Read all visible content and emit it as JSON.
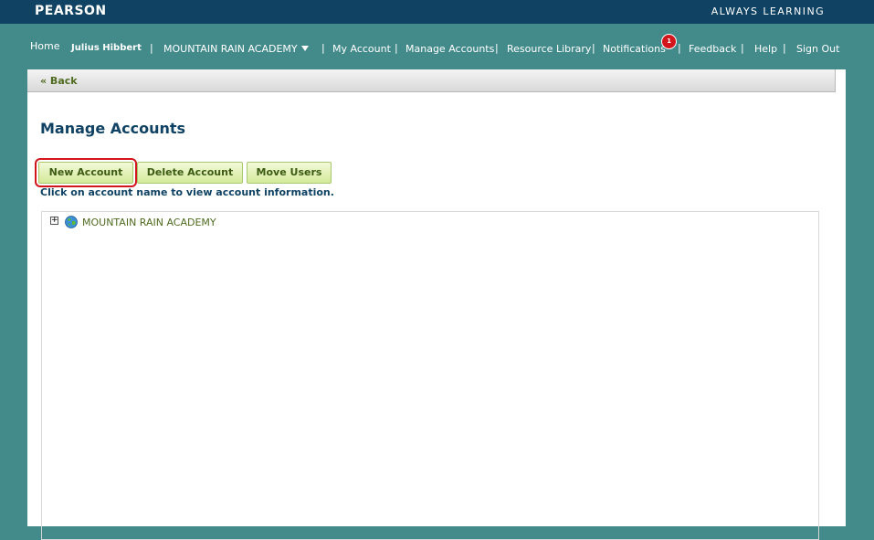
{
  "header": {
    "brand": "PEARSON",
    "tagline": "ALWAYS LEARNING"
  },
  "nav": {
    "home": "Home",
    "user": "Julius Hibbert",
    "org": "MOUNTAIN RAIN ACADEMY",
    "my_account": "My Account",
    "manage_accounts": "Manage Accounts",
    "resource_library": "Resource Library",
    "notifications": "Notifications",
    "notification_count": "1",
    "feedback": "Feedback",
    "help": "Help",
    "sign_out": "Sign Out",
    "separator": "|"
  },
  "backbar": {
    "back_label": "« Back"
  },
  "page": {
    "title": "Manage Accounts",
    "hint": "Click on account name to view account information."
  },
  "toolbar": {
    "new_account": "New Account",
    "delete_account": "Delete Account",
    "move_users": "Move Users"
  },
  "tree": {
    "items": [
      {
        "label": "MOUNTAIN RAIN ACADEMY",
        "expander": "+",
        "icon": "globe-icon"
      }
    ]
  },
  "colors": {
    "header_bg": "#0f4263",
    "page_bg": "#438a8b",
    "accent_green": "#4f6b1f",
    "highlight_red": "#d2161c"
  }
}
